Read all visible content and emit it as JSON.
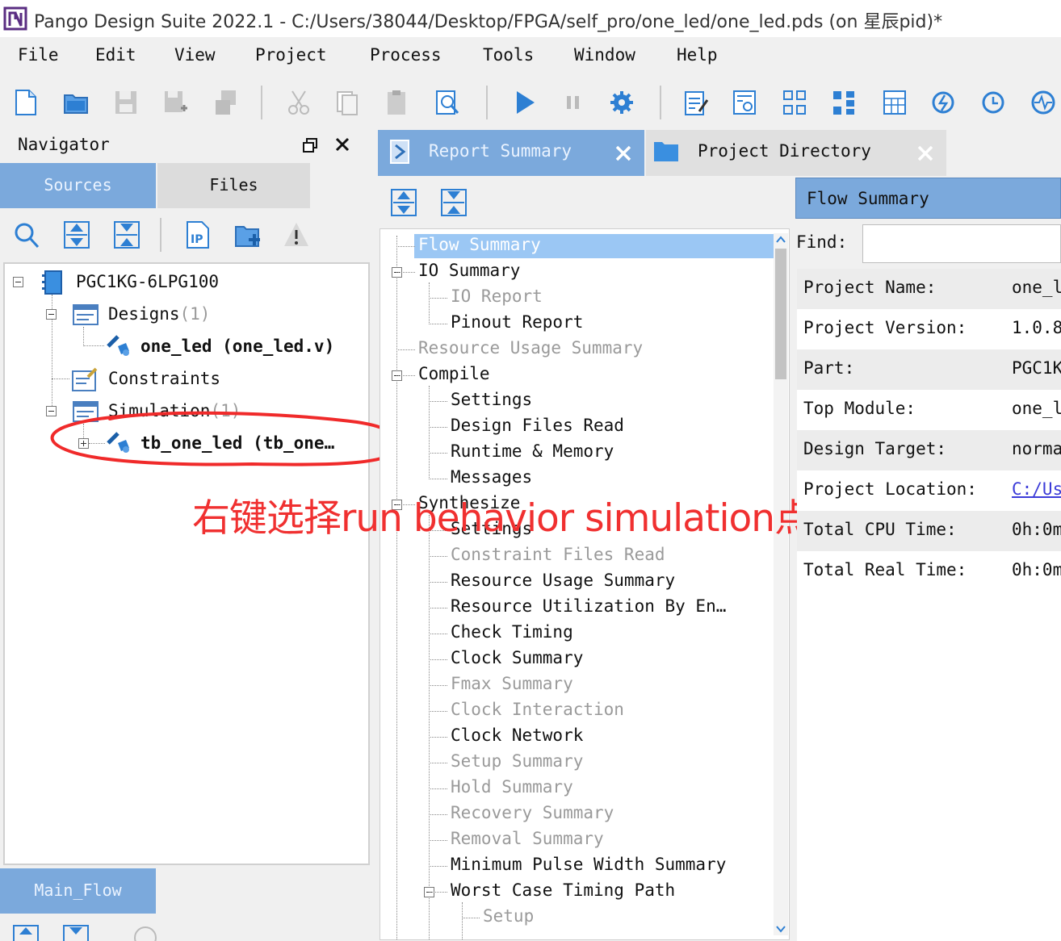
{
  "window": {
    "title": "Pango Design Suite 2022.1 - C:/Users/38044/Desktop/FPGA/self_pro/one_led/one_led.pds (on 星辰pid)*"
  },
  "menu": [
    "File",
    "Edit",
    "View",
    "Project",
    "Process",
    "Tools",
    "Window",
    "Help"
  ],
  "toolbar": {
    "icons": [
      "new-file-icon",
      "open-folder-icon",
      "save-icon",
      "save-as-icon",
      "save-all-icon",
      "cut-icon",
      "copy-icon",
      "paste-icon",
      "find-icon",
      "run-icon",
      "pause-icon",
      "settings-icon",
      "report-edit-icon",
      "report-view-icon",
      "layout-grid-icon",
      "hierarchy-icon",
      "table-icon",
      "refresh-icon",
      "timer-icon",
      "waveform-icon"
    ]
  },
  "navigator": {
    "title": "Navigator",
    "tabs": [
      "Sources",
      "Files"
    ],
    "active_tab": "Sources",
    "tree": {
      "device": "PGC1KG-6LPG100",
      "designs_label": "Designs",
      "designs_count": "(1)",
      "design_item": "one_led (one_led.v)",
      "constraints_label": "Constraints",
      "simulation_label": "Simulation",
      "simulation_count": "(1)",
      "simulation_item": "tb_one_led (tb_one…"
    },
    "bottom_tab": "Main_Flow"
  },
  "report_tabs": [
    {
      "label": "Report Summary",
      "active": true
    },
    {
      "label": "Project Directory",
      "active": false
    }
  ],
  "report_tree": {
    "selected": "Flow Summary",
    "items": [
      {
        "label": "Flow Summary",
        "level": 0,
        "grey": false
      },
      {
        "label": "IO Summary",
        "level": 0,
        "grey": false
      },
      {
        "label": "IO Report",
        "level": 1,
        "grey": true
      },
      {
        "label": "Pinout Report",
        "level": 1,
        "grey": false
      },
      {
        "label": "Resource Usage Summary",
        "level": 0,
        "grey": true
      },
      {
        "label": "Compile",
        "level": 0,
        "grey": false
      },
      {
        "label": "Settings",
        "level": 1,
        "grey": false
      },
      {
        "label": "Design Files Read",
        "level": 1,
        "grey": false
      },
      {
        "label": "Runtime & Memory",
        "level": 1,
        "grey": false
      },
      {
        "label": "Messages",
        "level": 1,
        "grey": false
      },
      {
        "label": "Synthesize",
        "level": 0,
        "grey": false
      },
      {
        "label": "Settings",
        "level": 1,
        "grey": false
      },
      {
        "label": "Constraint Files Read",
        "level": 1,
        "grey": true
      },
      {
        "label": "Resource Usage Summary",
        "level": 1,
        "grey": false
      },
      {
        "label": "Resource Utilization By En…",
        "level": 1,
        "grey": false
      },
      {
        "label": "Check Timing",
        "level": 1,
        "grey": false
      },
      {
        "label": "Clock Summary",
        "level": 1,
        "grey": false
      },
      {
        "label": "Fmax Summary",
        "level": 1,
        "grey": true
      },
      {
        "label": "Clock Interaction",
        "level": 1,
        "grey": true
      },
      {
        "label": "Clock Network",
        "level": 1,
        "grey": false
      },
      {
        "label": "Setup Summary",
        "level": 1,
        "grey": true
      },
      {
        "label": "Hold Summary",
        "level": 1,
        "grey": true
      },
      {
        "label": "Recovery Summary",
        "level": 1,
        "grey": true
      },
      {
        "label": "Removal Summary",
        "level": 1,
        "grey": true
      },
      {
        "label": "Minimum Pulse Width Summary",
        "level": 1,
        "grey": false
      },
      {
        "label": "Worst Case Timing Path",
        "level": 1,
        "grey": false
      },
      {
        "label": "Setup",
        "level": 2,
        "grey": true
      }
    ]
  },
  "flow_summary": {
    "header": "Flow Summary",
    "find_label": "Find:",
    "find_value": "",
    "rows": [
      {
        "key": "Project Name:",
        "value": "one_l"
      },
      {
        "key": "Project Version:",
        "value": "1.0.8"
      },
      {
        "key": "Part:",
        "value": "PGC1K"
      },
      {
        "key": "Top Module:",
        "value": "one_l"
      },
      {
        "key": "Design Target:",
        "value": "norma"
      },
      {
        "key": "Project Location:",
        "value": "C:/Us"
      },
      {
        "key": "Total CPU Time:",
        "value": "0h:0m"
      },
      {
        "key": "Total Real Time:",
        "value": "0h:0m"
      }
    ]
  },
  "annotation": {
    "text": "右键选择run behavior simulation点击",
    "color": "#f03030"
  },
  "colors": {
    "accent": "#7ba9dc",
    "selection": "#9bc7f4",
    "annotation": "#f03030"
  }
}
